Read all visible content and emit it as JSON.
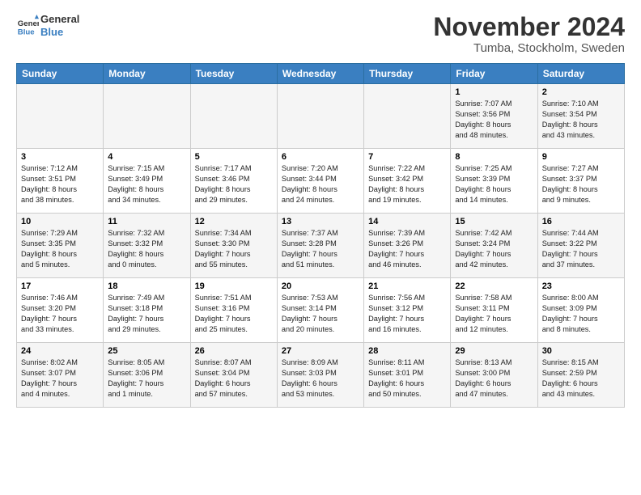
{
  "header": {
    "logo_line1": "General",
    "logo_line2": "Blue",
    "month": "November 2024",
    "location": "Tumba, Stockholm, Sweden"
  },
  "days_of_week": [
    "Sunday",
    "Monday",
    "Tuesday",
    "Wednesday",
    "Thursday",
    "Friday",
    "Saturday"
  ],
  "weeks": [
    [
      {
        "day": "",
        "text": ""
      },
      {
        "day": "",
        "text": ""
      },
      {
        "day": "",
        "text": ""
      },
      {
        "day": "",
        "text": ""
      },
      {
        "day": "",
        "text": ""
      },
      {
        "day": "1",
        "text": "Sunrise: 7:07 AM\nSunset: 3:56 PM\nDaylight: 8 hours\nand 48 minutes."
      },
      {
        "day": "2",
        "text": "Sunrise: 7:10 AM\nSunset: 3:54 PM\nDaylight: 8 hours\nand 43 minutes."
      }
    ],
    [
      {
        "day": "3",
        "text": "Sunrise: 7:12 AM\nSunset: 3:51 PM\nDaylight: 8 hours\nand 38 minutes."
      },
      {
        "day": "4",
        "text": "Sunrise: 7:15 AM\nSunset: 3:49 PM\nDaylight: 8 hours\nand 34 minutes."
      },
      {
        "day": "5",
        "text": "Sunrise: 7:17 AM\nSunset: 3:46 PM\nDaylight: 8 hours\nand 29 minutes."
      },
      {
        "day": "6",
        "text": "Sunrise: 7:20 AM\nSunset: 3:44 PM\nDaylight: 8 hours\nand 24 minutes."
      },
      {
        "day": "7",
        "text": "Sunrise: 7:22 AM\nSunset: 3:42 PM\nDaylight: 8 hours\nand 19 minutes."
      },
      {
        "day": "8",
        "text": "Sunrise: 7:25 AM\nSunset: 3:39 PM\nDaylight: 8 hours\nand 14 minutes."
      },
      {
        "day": "9",
        "text": "Sunrise: 7:27 AM\nSunset: 3:37 PM\nDaylight: 8 hours\nand 9 minutes."
      }
    ],
    [
      {
        "day": "10",
        "text": "Sunrise: 7:29 AM\nSunset: 3:35 PM\nDaylight: 8 hours\nand 5 minutes."
      },
      {
        "day": "11",
        "text": "Sunrise: 7:32 AM\nSunset: 3:32 PM\nDaylight: 8 hours\nand 0 minutes."
      },
      {
        "day": "12",
        "text": "Sunrise: 7:34 AM\nSunset: 3:30 PM\nDaylight: 7 hours\nand 55 minutes."
      },
      {
        "day": "13",
        "text": "Sunrise: 7:37 AM\nSunset: 3:28 PM\nDaylight: 7 hours\nand 51 minutes."
      },
      {
        "day": "14",
        "text": "Sunrise: 7:39 AM\nSunset: 3:26 PM\nDaylight: 7 hours\nand 46 minutes."
      },
      {
        "day": "15",
        "text": "Sunrise: 7:42 AM\nSunset: 3:24 PM\nDaylight: 7 hours\nand 42 minutes."
      },
      {
        "day": "16",
        "text": "Sunrise: 7:44 AM\nSunset: 3:22 PM\nDaylight: 7 hours\nand 37 minutes."
      }
    ],
    [
      {
        "day": "17",
        "text": "Sunrise: 7:46 AM\nSunset: 3:20 PM\nDaylight: 7 hours\nand 33 minutes."
      },
      {
        "day": "18",
        "text": "Sunrise: 7:49 AM\nSunset: 3:18 PM\nDaylight: 7 hours\nand 29 minutes."
      },
      {
        "day": "19",
        "text": "Sunrise: 7:51 AM\nSunset: 3:16 PM\nDaylight: 7 hours\nand 25 minutes."
      },
      {
        "day": "20",
        "text": "Sunrise: 7:53 AM\nSunset: 3:14 PM\nDaylight: 7 hours\nand 20 minutes."
      },
      {
        "day": "21",
        "text": "Sunrise: 7:56 AM\nSunset: 3:12 PM\nDaylight: 7 hours\nand 16 minutes."
      },
      {
        "day": "22",
        "text": "Sunrise: 7:58 AM\nSunset: 3:11 PM\nDaylight: 7 hours\nand 12 minutes."
      },
      {
        "day": "23",
        "text": "Sunrise: 8:00 AM\nSunset: 3:09 PM\nDaylight: 7 hours\nand 8 minutes."
      }
    ],
    [
      {
        "day": "24",
        "text": "Sunrise: 8:02 AM\nSunset: 3:07 PM\nDaylight: 7 hours\nand 4 minutes."
      },
      {
        "day": "25",
        "text": "Sunrise: 8:05 AM\nSunset: 3:06 PM\nDaylight: 7 hours\nand 1 minute."
      },
      {
        "day": "26",
        "text": "Sunrise: 8:07 AM\nSunset: 3:04 PM\nDaylight: 6 hours\nand 57 minutes."
      },
      {
        "day": "27",
        "text": "Sunrise: 8:09 AM\nSunset: 3:03 PM\nDaylight: 6 hours\nand 53 minutes."
      },
      {
        "day": "28",
        "text": "Sunrise: 8:11 AM\nSunset: 3:01 PM\nDaylight: 6 hours\nand 50 minutes."
      },
      {
        "day": "29",
        "text": "Sunrise: 8:13 AM\nSunset: 3:00 PM\nDaylight: 6 hours\nand 47 minutes."
      },
      {
        "day": "30",
        "text": "Sunrise: 8:15 AM\nSunset: 2:59 PM\nDaylight: 6 hours\nand 43 minutes."
      }
    ]
  ]
}
